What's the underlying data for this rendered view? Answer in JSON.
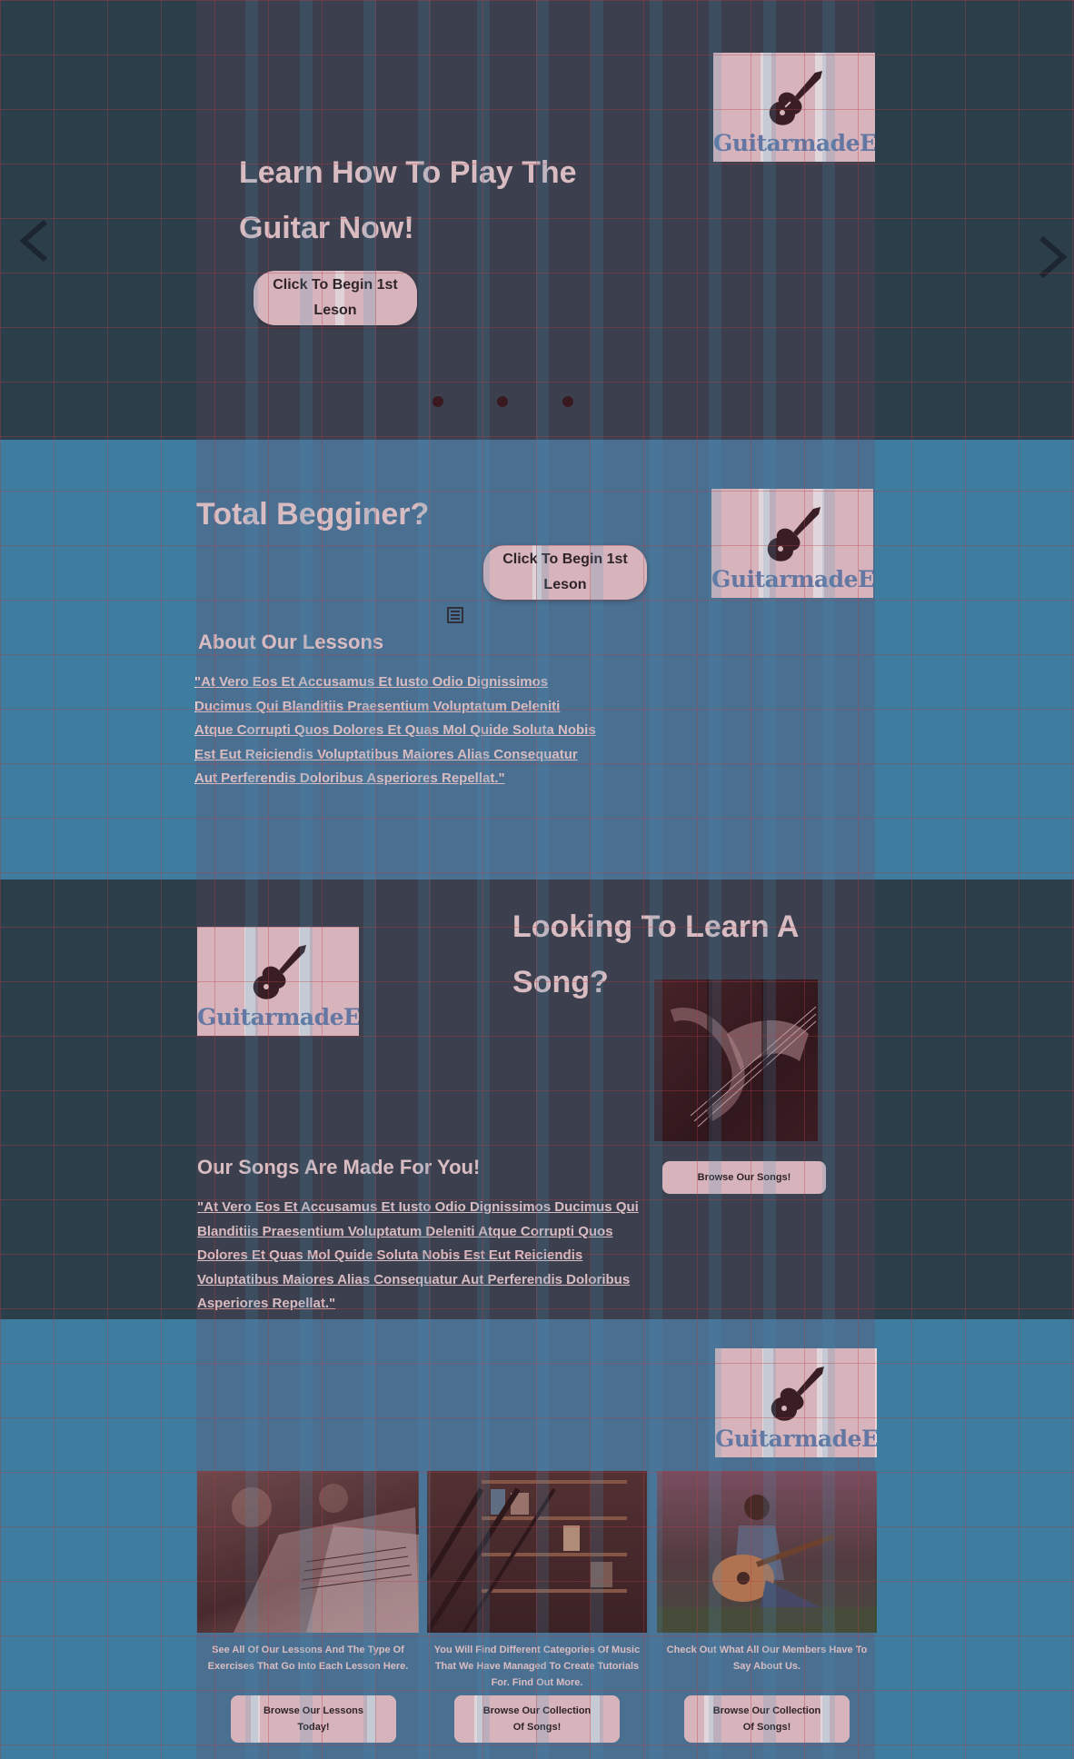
{
  "logo": {
    "text": "GuitarmadeEZ",
    "icon": "electric-guitar-icon"
  },
  "hero": {
    "title_line1": "Learn How To Play The",
    "title_line2": "Guitar Now!",
    "button_line1": "Click To Begin 1st",
    "button_line2": "Leson",
    "prev_icon": "chevron-left-icon",
    "next_icon": "chevron-right-icon",
    "slides": 3
  },
  "beginner": {
    "title": "Total Begginer?",
    "button_line1": "Click To Begin 1st",
    "button_line2": "Leson",
    "subtitle": "About Our Lessons",
    "paragraph": "\"At Vero Eos Et Accusamus Et Iusto Odio Dignissimos Ducimus Qui Blanditiis Praesentium Voluptatum Deleniti Atque Corrupti Quos Dolores Et Quas Mol Quide Soluta Nobis Est Eut Reiciendis Voluptatibus Maiores Alias Consequatur Aut Perferendis Doloribus Asperiores Repellat.\"",
    "broken_image_icon": "broken-image-icon"
  },
  "songs": {
    "title_line1": "Looking To Learn A",
    "title_line2": "Song?",
    "subtitle": "Our Songs Are Made For You!",
    "paragraph": "\"At Vero Eos Et Accusamus Et Iusto Odio Dignissimos Ducimus Qui Blanditiis Praesentium Voluptatum Deleniti Atque Corrupti Quos Dolores Et Quas Mol Quide Soluta Nobis Est Eut Reiciendis Voluptatibus Maiores Alias Consequatur Aut Perferendis Doloribus Asperiores Repellat.\"",
    "button": "Browse Our Songs!"
  },
  "cards": [
    {
      "text": "See All Of Our Lessons And The Type Of Exercises That Go Into Each Lesson Here.",
      "button_line1": "Browse Our Lessons",
      "button_line2": "Today!"
    },
    {
      "text": "You Will Find Different Categories Of Music That We Have Managed To Create Tutorials For. Find Out More.",
      "button_line1": "Browse Our Collection",
      "button_line2": "Of Songs!"
    },
    {
      "text": "Check Out What All Our Members Have To Say About Us.",
      "button_line1": "Browse Our Collection",
      "button_line2": "Of Songs!"
    }
  ],
  "colors": {
    "dark_bg": "#2c3e4a",
    "blue_bg": "#3e7ca0",
    "pink": "#f2d4d6",
    "text": "#f4dede",
    "logo_text": "#5f86b8"
  }
}
